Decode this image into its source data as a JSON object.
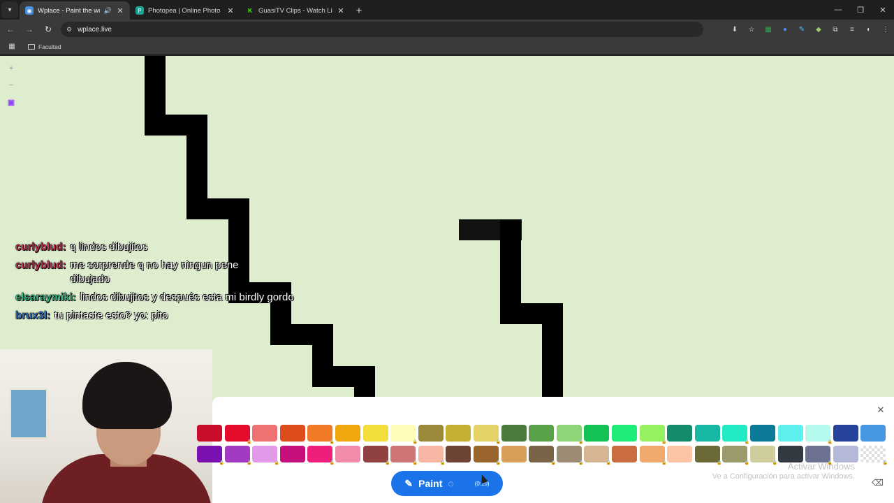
{
  "browser": {
    "tabs": [
      {
        "title": "Wplace - Paint the world",
        "active": true,
        "audio": true,
        "favicon_color": "#4a90e2"
      },
      {
        "title": "Photopea | Online Photo Editor",
        "active": false,
        "audio": false,
        "favicon_color": "#18a497"
      },
      {
        "title": "GuasiTV Clips - Watch Live on Kick",
        "active": false,
        "audio": false,
        "favicon_color": "#53fc18"
      }
    ],
    "url": "wplace.live",
    "bookmarks": [
      {
        "label": "Facultad"
      }
    ]
  },
  "chat": [
    {
      "user": "curlyblud:",
      "color": "#e0325a",
      "text": "q lindos dibujitos"
    },
    {
      "user": "curlyblud:",
      "color": "#e0325a",
      "text": "me sorprende q no hay ningun pene dibujado"
    },
    {
      "user": "elsaraymiki:",
      "color": "#2fcf8f",
      "text": "lindos dibujitos y después esta mi birdly gordo"
    },
    {
      "user": "brux3l:",
      "color": "#2f7fd8",
      "text": "tu pintaste esto? yo: pito"
    }
  ],
  "palette": {
    "row1": [
      "#c90d2b",
      "#e50c2b",
      "#ee7272",
      "#dd4e1c",
      "#f07a28",
      "#f0a70e",
      "#f3dd3a",
      "#fffcb7",
      "#9a8a39",
      "#c6b034",
      "#e4d467",
      "#497c3d",
      "#5aa24a",
      "#8fd476",
      "#14c155",
      "#1eee79",
      "#95f25e",
      "#128c6c",
      "#16b8a3",
      "#21eac5",
      "#0c7b98",
      "#5df0ef",
      "#b6f9ef",
      "#26459a",
      "#4796e1"
    ],
    "row2": [
      "#7a10b0",
      "#a33bc2",
      "#e29ae8",
      "#c60e7d",
      "#ee1f7b",
      "#f08ba9",
      "#8f4241",
      "#ce7675",
      "#f6b6a3",
      "#6d4333",
      "#9a652c",
      "#d89f59",
      "#7a6447",
      "#9c8c74",
      "#d6b692",
      "#c96d40",
      "#f1a86c",
      "#fbc4a5",
      "#6b6a37",
      "#9b9a6a",
      "#cfcd9c",
      "#333940",
      "#6c7290",
      "#b4b9d8",
      "transparent"
    ]
  },
  "paint_button": {
    "label": "Paint",
    "count": "(0:10)"
  },
  "watermark": {
    "line1": "Activar Windows",
    "line2": "Ve a Configuración para activar Windows."
  }
}
